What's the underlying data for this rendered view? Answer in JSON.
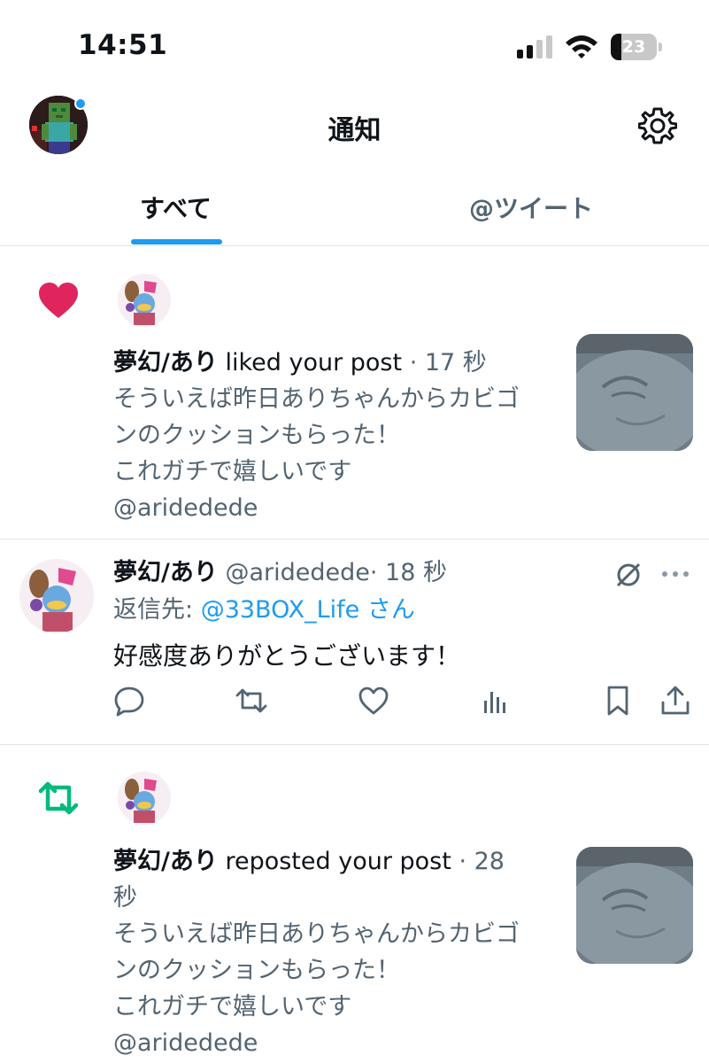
{
  "status_bar": {
    "time": "14:51",
    "battery_level": "23"
  },
  "header": {
    "title": "通知"
  },
  "tabs": [
    {
      "label": "すべて",
      "active": true
    },
    {
      "label": "@ツイート",
      "active": false
    }
  ],
  "notifications": [
    {
      "type": "like",
      "user_name": "夢幻/あり",
      "action_text": "liked your post",
      "time": "· 17 秒",
      "post_lines": [
        "そういえば昨日ありちゃんからカビゴ",
        "ンのクッションもらった！",
        "これガチで嬉しいです",
        "@aridedede"
      ]
    },
    {
      "type": "reply",
      "user_name": "夢幻/あり",
      "handle": "@aridedede",
      "time": "· 18 秒",
      "reply_prefix": "返信先: ",
      "reply_to": "@33BOX_Life さん",
      "body": "好感度ありがとうございます！"
    },
    {
      "type": "repost",
      "user_name": "夢幻/あり",
      "action_text": "reposted your post",
      "time_line1": "· 28",
      "time_line2": "秒",
      "post_lines": [
        "そういえば昨日ありちゃんからカビゴ",
        "ンのクッションもらった！",
        "これガチで嬉しいです",
        "@aridedede"
      ]
    }
  ],
  "colors": {
    "accent": "#1d9bf0",
    "like": "#e0245e",
    "repost": "#00ba7c",
    "muted": "#536471"
  },
  "icons": [
    "signal-icon",
    "wifi-icon",
    "battery-icon",
    "gear-icon",
    "heart-icon",
    "repost-icon",
    "reply-icon",
    "like-outline-icon",
    "views-icon",
    "bookmark-icon",
    "share-icon",
    "grok-icon",
    "more-icon"
  ]
}
